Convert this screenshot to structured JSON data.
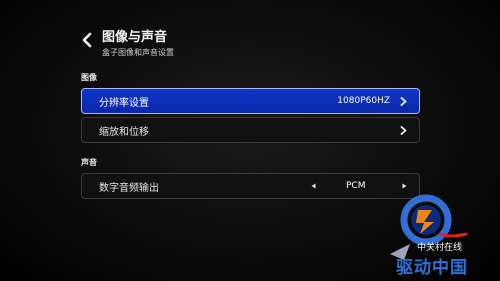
{
  "header": {
    "title": "图像与声音",
    "subtitle": "盒子图像和声音设置"
  },
  "sections": [
    {
      "label": "图像",
      "items": [
        {
          "label": "分辨率设置",
          "value": "1080P60HZ"
        },
        {
          "label": "缩放和位移",
          "value": ""
        }
      ]
    },
    {
      "label": "声音",
      "items": [
        {
          "label": "数字音频输出",
          "value": "PCM"
        }
      ]
    }
  ],
  "watermark": {
    "line1": "中关村在线",
    "line2": "驱动中国"
  },
  "colors": {
    "selected_bg": "#0a2fb8",
    "selected_border": "#a9b9ff",
    "row_border": "#3a3a3a",
    "watermark_blue": "#2f6fd6",
    "watermark_orange": "#e8871e"
  }
}
